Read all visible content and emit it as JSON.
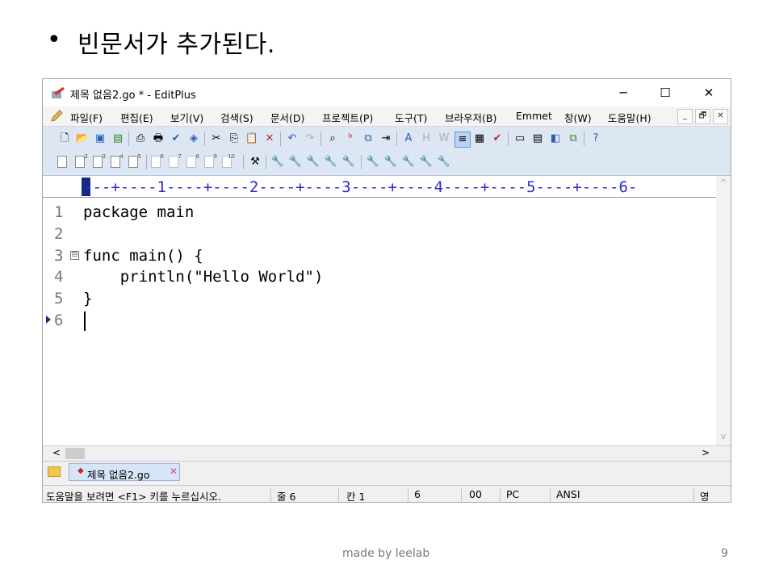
{
  "slide": {
    "bullet": "•",
    "title": "빈문서가 추가된다.",
    "credit": "made by leelab",
    "page_number": "9"
  },
  "window": {
    "title": "제목 없음2.go * - EditPlus",
    "controls": {
      "minimize": "─",
      "maximize": "☐",
      "close": "✕"
    }
  },
  "menu": {
    "items": [
      "파일(F)",
      "편집(E)",
      "보기(V)",
      "검색(S)",
      "문서(D)",
      "프로젝트(P)",
      "도구(T)",
      "브라우저(B)",
      "Emmet",
      "창(W)",
      "도움말(H)"
    ],
    "mdi_controls": [
      "_",
      "🗗",
      "✕"
    ]
  },
  "editor": {
    "ruler": "---+----1----+----2----+----3----+----4----+----5----+----6-",
    "line_numbers": [
      "1",
      "2",
      "3",
      "4",
      "5",
      "6"
    ],
    "lines": [
      "package main",
      "",
      "func main() {",
      "    println(\"Hello World\")",
      "}",
      ""
    ],
    "fold_marker": "⊟"
  },
  "tabs": {
    "active": {
      "mark": "◆",
      "label": "제목 없음2.go",
      "close": "✕"
    }
  },
  "statusbar": {
    "help": "도움말을 보려면 <F1> 키를 누르십시오.",
    "line": "줄 6",
    "col": "칸 1",
    "lines_total": "6",
    "code": "00",
    "platform": "PC",
    "encoding": "ANSI",
    "ime": "영"
  },
  "scroll": {
    "left": "<",
    "right": ">",
    "up": "^",
    "down": "v"
  },
  "toolbar_icons": [
    "new-file-icon",
    "open-folder-icon",
    "save-icon",
    "save-all-icon",
    "print-preview-icon",
    "print-icon",
    "spell-check-icon",
    "browser-view-icon",
    "cut-icon",
    "copy-icon",
    "paste-icon",
    "delete-icon",
    "undo-icon",
    "redo-icon",
    "find-icon",
    "replace-icon",
    "find-in-files-icon",
    "goto-line-icon",
    "font-icon",
    "hex-icon",
    "word-wrap-icon",
    "line-number-icon",
    "column-select-icon",
    "check-icon",
    "view-icon",
    "cliptext-icon",
    "directory-icon",
    "output-icon",
    "help-icon"
  ]
}
